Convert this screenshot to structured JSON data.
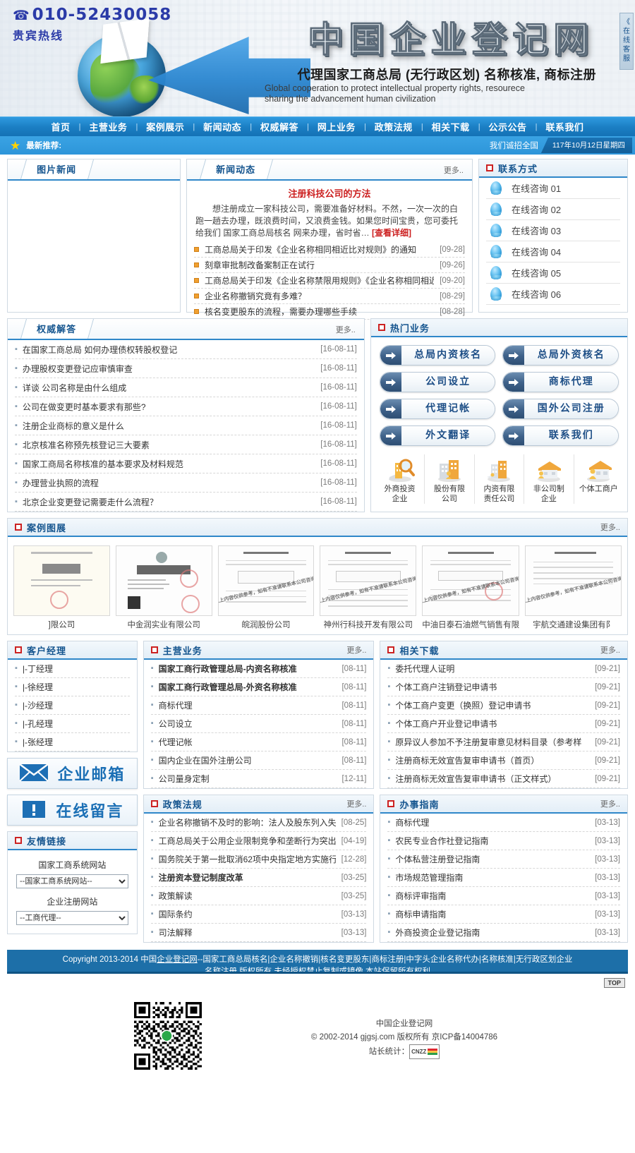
{
  "banner": {
    "phone_icon": "phone-icon",
    "phone": "010-52430058",
    "hotline_label": "贵宾热线",
    "site_title": "中国企业登记网",
    "slogan": "代理国家工商总局 (无行政区划) 名称核准, 商标注册",
    "slogan_en_line1": "Global cooperation to protect intellectual property rights, resourece",
    "slogan_en_line2": "sharing the advancement  human civilization",
    "side_service": "《 在线客服"
  },
  "nav": {
    "items": [
      "首页",
      "主营业务",
      "案例展示",
      "新闻动态",
      "权威解答",
      "网上业务",
      "政策法规",
      "相关下载",
      "公示公告",
      "联系我们"
    ],
    "separator": "|"
  },
  "subbar": {
    "star_icon": "star-icon",
    "recommend_label": "最新推荐:",
    "hiring": "我们诚招全国",
    "date": "117年10月12日星期四"
  },
  "picnews": {
    "title": "图片新闻"
  },
  "news": {
    "title": "新闻动态",
    "more": "更多..",
    "headline": "注册科技公司的方法",
    "abstract": "想注册成立一家科技公司，需要准备好材料。不然，一次一次的白跑一趟去办理，既浪费时间，又浪费金钱。如果您时间宝贵，您可委托给我们 国家工商总局核名 网来办理，省时省…",
    "detail_link": "[查看详细]",
    "items": [
      {
        "title": "工商总局关于印发《企业名称相同相近比对规则》的通知",
        "date": "[09-28]"
      },
      {
        "title": "刻章审批制改备案制正在试行",
        "date": "[09-26]"
      },
      {
        "title": "工商总局关于印发《企业名称禁限用规则》《企业名称相同相近",
        "date": "[09-20]"
      },
      {
        "title": "企业名称撤销究竟有多难？",
        "date": "[08-29]"
      },
      {
        "title": "核名变更股东的流程，需要办理哪些手续",
        "date": "[08-28]"
      }
    ]
  },
  "contact": {
    "title": "联系方式",
    "items": [
      "在线咨询 01",
      "在线咨询 02",
      "在线咨询 03",
      "在线咨询 04",
      "在线咨询 05",
      "在线咨询 06"
    ]
  },
  "qa": {
    "title": "权威解答",
    "more": "更多..",
    "items": [
      {
        "title": "在国家工商总局 如何办理债权转股权登记",
        "date": "[16-08-11]"
      },
      {
        "title": "办理股权变更登记应审慎审查",
        "date": "[16-08-11]"
      },
      {
        "title": "详谈 公司名称是由什么组成",
        "date": "[16-08-11]"
      },
      {
        "title": "公司在做变更时基本要求有那些?",
        "date": "[16-08-11]"
      },
      {
        "title": "注册企业商标的意义是什么",
        "date": "[16-08-11]"
      },
      {
        "title": "北京核准名称预先核登记三大要素",
        "date": "[16-08-11]"
      },
      {
        "title": "国家工商局名称核准的基本要求及材料规范",
        "date": "[16-08-11]"
      },
      {
        "title": "办理营业执照的流程",
        "date": "[16-08-11]"
      },
      {
        "title": "北京企业变更登记需要走什么流程？",
        "date": "[16-08-11]"
      }
    ]
  },
  "hot": {
    "title": "热门业务",
    "buttons": [
      "总局内资核名",
      "总局外资核名",
      "公司设立",
      "商标代理",
      "代理记帐",
      "国外公司注册",
      "外文翻译",
      "联系我们"
    ],
    "entities": [
      {
        "icon": "magnifier-building-icon",
        "label": "外商投资\n企业"
      },
      {
        "icon": "building-icon",
        "label": "股份有限\n公司"
      },
      {
        "icon": "city-icon",
        "label": "内资有限\n责任公司"
      },
      {
        "icon": "house-icon",
        "label": "非公司制\n企业"
      },
      {
        "icon": "shop-icon",
        "label": "个体工商户"
      }
    ]
  },
  "cases": {
    "title": "案例图展",
    "more": "更多..",
    "items": [
      {
        "caption": "]限公司",
        "kind": "certificate"
      },
      {
        "caption": "中金润实业有限公司",
        "kind": "license"
      },
      {
        "caption": "皖润股份公司",
        "kind": "notice"
      },
      {
        "caption": "神州行科技开发有限公司",
        "kind": "notice"
      },
      {
        "caption": "中油日泰石油燃气销售有限",
        "kind": "notice"
      },
      {
        "caption": "宇航交通建设集团有阝",
        "kind": "notice"
      }
    ]
  },
  "managers": {
    "title": "客户经理",
    "items": [
      "|-丁经理",
      "|-徐经理",
      "|-沙经理",
      "|-孔经理",
      "|-张经理"
    ]
  },
  "mail_button": {
    "icon": "envelope-icon",
    "label": "企业邮箱"
  },
  "message_button": {
    "icon": "exclamation-icon",
    "label": "在线留言"
  },
  "friend_links": {
    "title": "友情链接",
    "group1_label": "国家工商系统网站",
    "group1_selected": "--国家工商系统网站--",
    "group2_label": "企业注册网站",
    "group2_selected": "--工商代理--"
  },
  "main_business": {
    "title": "主营业务",
    "more": "更多..",
    "items": [
      {
        "title": "国家工商行政管理总局-内资名称核准",
        "date": "[08-11]",
        "bold": true
      },
      {
        "title": "国家工商行政管理总局-外资名称核准",
        "date": "[08-11]",
        "bold": true
      },
      {
        "title": "商标代理",
        "date": "[08-11]",
        "bold": false
      },
      {
        "title": "公司设立",
        "date": "[08-11]",
        "bold": false
      },
      {
        "title": "代理记帐",
        "date": "[08-11]",
        "bold": false
      },
      {
        "title": "国内企业在国外注册公司",
        "date": "[08-11]",
        "bold": false
      },
      {
        "title": "公司量身定制",
        "date": "[12-11]",
        "bold": false
      }
    ]
  },
  "downloads": {
    "title": "相关下载",
    "more": "更多..",
    "items": [
      {
        "title": "委托代理人证明",
        "date": "[09-21]"
      },
      {
        "title": "个体工商户注销登记申请书",
        "date": "[09-21]"
      },
      {
        "title": "个体工商户变更（换照）登记申请书",
        "date": "[09-21]"
      },
      {
        "title": "个体工商户开业登记申请书",
        "date": "[09-21]"
      },
      {
        "title": "原异议人参加不予注册复审意见材料目录（参考样",
        "date": "[09-21]"
      },
      {
        "title": "注册商标无效宣告复审申请书（首页）",
        "date": "[09-21]"
      },
      {
        "title": "注册商标无效宣告复审申请书（正文样式）",
        "date": "[09-21]"
      }
    ]
  },
  "policies": {
    "title": "政策法规",
    "more": "更多..",
    "items": [
      {
        "title": "企业名称撤销不及时的影响：法人及股东列入失信",
        "date": "[08-25]",
        "bold": false
      },
      {
        "title": "工商总局关于公用企业限制竞争和垄断行为突出问",
        "date": "[04-19]",
        "bold": false
      },
      {
        "title": "国务院关于第一批取消62项中央指定地方实施行政",
        "date": "[12-28]",
        "bold": false
      },
      {
        "title": "注册资本登记制度改革",
        "date": "[03-25]",
        "bold": true
      },
      {
        "title": "政策解读",
        "date": "[03-25]",
        "bold": false
      },
      {
        "title": "国际条约",
        "date": "[03-13]",
        "bold": false
      },
      {
        "title": "司法解释",
        "date": "[03-13]",
        "bold": false
      }
    ]
  },
  "guides": {
    "title": "办事指南",
    "more": "更多..",
    "items": [
      {
        "title": "商标代理",
        "date": "[03-13]"
      },
      {
        "title": "农民专业合作社登记指南",
        "date": "[03-13]"
      },
      {
        "title": "个体私营注册登记指南",
        "date": "[03-13]"
      },
      {
        "title": "市场规范管理指南",
        "date": "[03-13]"
      },
      {
        "title": "商标评审指南",
        "date": "[03-13]"
      },
      {
        "title": "商标申请指南",
        "date": "[03-13]"
      },
      {
        "title": "外商投资企业登记指南",
        "date": "[03-13]"
      }
    ]
  },
  "footer": {
    "copyright_pre": "Copyright 2013-2014 中国",
    "copyright_link": "企业登记网",
    "copyright_post": "--国家工商总局核名|企业名称撤销|核名变更股东|商标注册|中字头企业名称代办|名称核准|无行政区划企业",
    "copyright_line2": "名称注册 版权所有 未经授权禁止复制或镜像 本站保留所有权利",
    "top_button": "TOP",
    "site_name": "中国企业登记网",
    "copy_line": "© 2002-2014 gjgsj.com 版权所有 京ICP备14004786",
    "stat_label": "站长统计：",
    "stat_badge": "CNZZ"
  },
  "colors": {
    "nav_blue": "#1b7fc4",
    "accent_blue": "#2f87c9",
    "title_blue": "#15558f",
    "red": "#cc2020",
    "footer_blue": "#1d6fa8"
  }
}
